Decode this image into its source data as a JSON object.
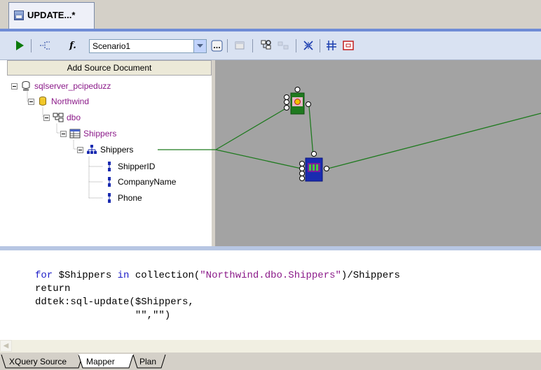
{
  "document_tab": {
    "title": "UPDATE...*"
  },
  "toolbar": {
    "scenario_value": "Scenario1",
    "run_icon": "play-icon",
    "function_label": "f."
  },
  "source_panel": {
    "add_source_label": "Add Source Document"
  },
  "tree": {
    "server": "sqlserver_pcipeduzz",
    "database": "Northwind",
    "schema": "dbo",
    "table": "Shippers",
    "element": "Shippers",
    "fields": [
      "ShipperID",
      "CompanyName",
      "Phone"
    ]
  },
  "code": {
    "line1_kw1": "for",
    "line1_var": " $Shippers ",
    "line1_kw2": "in",
    "line1_fn": " collection(",
    "line1_str": "\"Northwind.dbo.Shippers\"",
    "line1_rest": ")/Shippers",
    "line2": "return",
    "line3": "ddtek:sql-update($Shippers,",
    "line4": "                 \"\",\"\")"
  },
  "bottom_tabs": [
    "XQuery Source",
    "Mapper",
    "Plan"
  ],
  "colors": {
    "canvas": "#a3a3a3",
    "link_line": "#1f7a1f",
    "tree_purple": "#8b1a89",
    "keyword_blue": "#1e1ec8"
  }
}
